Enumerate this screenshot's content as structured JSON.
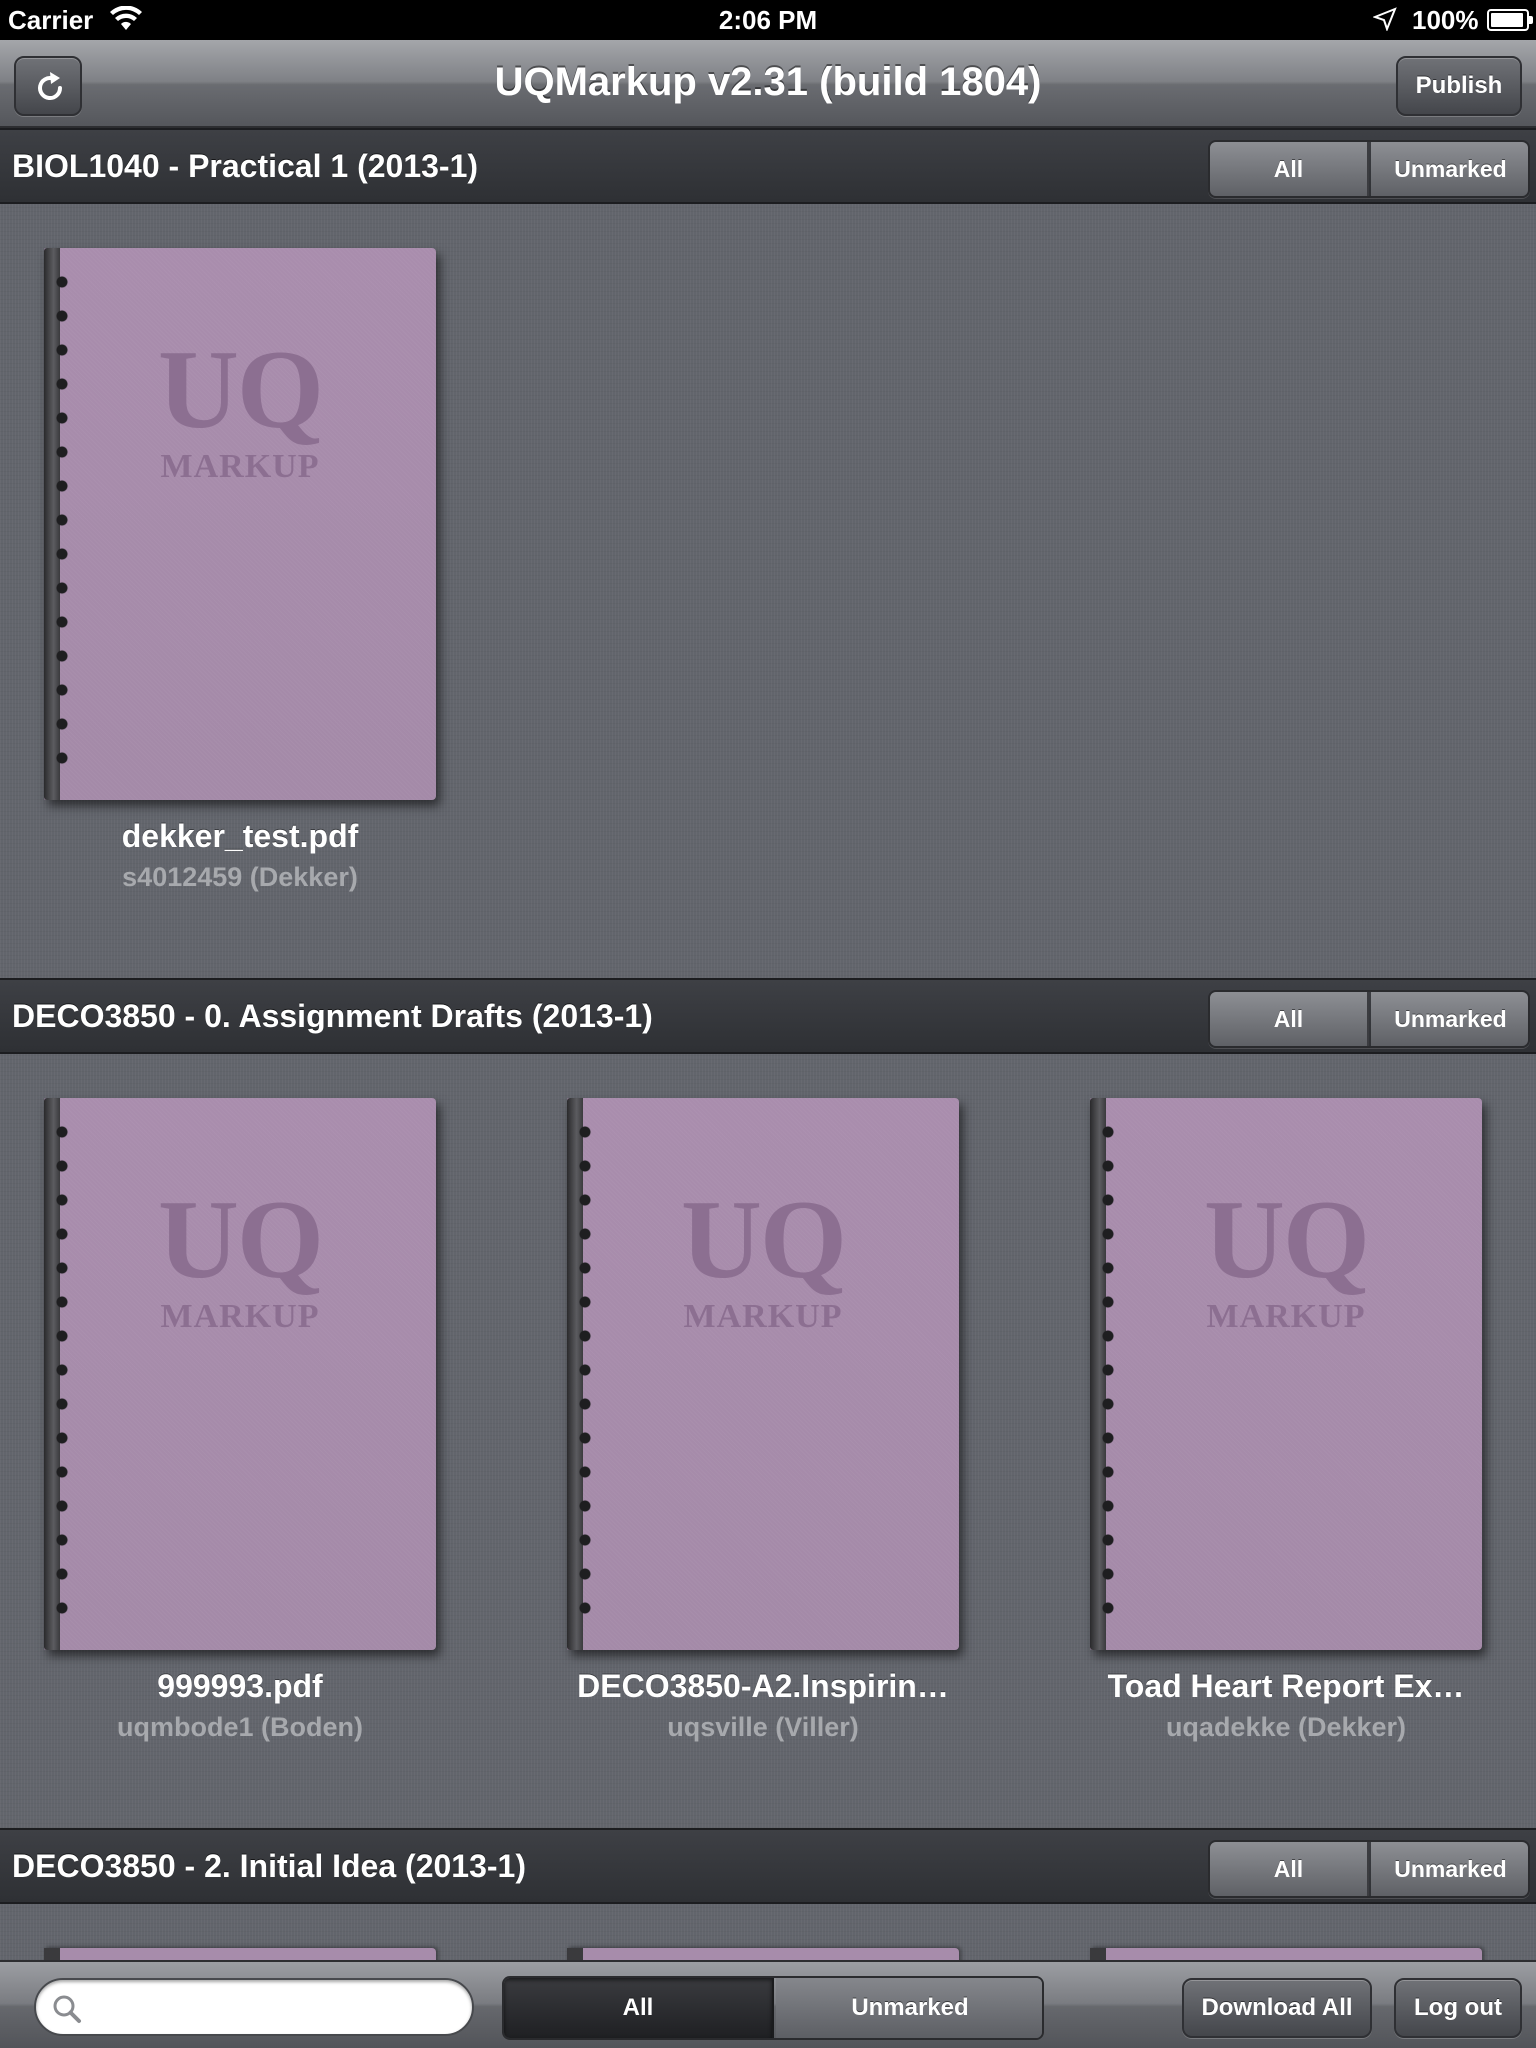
{
  "status_bar": {
    "carrier": "Carrier",
    "time": "2:06 PM",
    "battery": "100%"
  },
  "nav_bar": {
    "title": "UQMarkup v2.31 (build 1804)",
    "refresh_icon": "refresh-icon",
    "publish_label": "Publish"
  },
  "notebook_cover": {
    "logo_top": "UQ",
    "logo_bottom": "MARKUP",
    "color": "#a78cab"
  },
  "sections": [
    {
      "title": "BIOL1040 - Practical 1 (2013-1)",
      "filter_all": "All",
      "filter_unmarked": "Unmarked",
      "documents": [
        {
          "name": "dekker_test.pdf",
          "owner": "s4012459 (Dekker)"
        }
      ]
    },
    {
      "title": "DECO3850 - 0. Assignment Drafts (2013-1)",
      "filter_all": "All",
      "filter_unmarked": "Unmarked",
      "documents": [
        {
          "name": "999993.pdf",
          "owner": "uqmbode1 (Boden)"
        },
        {
          "name": "DECO3850-A2.Inspirin…",
          "owner": "uqsville (Viller)"
        },
        {
          "name": "Toad Heart Report Ex…",
          "owner": "uqadekke (Dekker)"
        }
      ]
    },
    {
      "title": "DECO3850 - 2. Initial Idea (2013-1)",
      "filter_all": "All",
      "filter_unmarked": "Unmarked",
      "documents": []
    }
  ],
  "toolbar": {
    "search_placeholder": "",
    "search_value": "",
    "filter_all": "All",
    "filter_unmarked": "Unmarked",
    "filter_selected": "All",
    "download_all_label": "Download All",
    "logout_label": "Log out"
  }
}
